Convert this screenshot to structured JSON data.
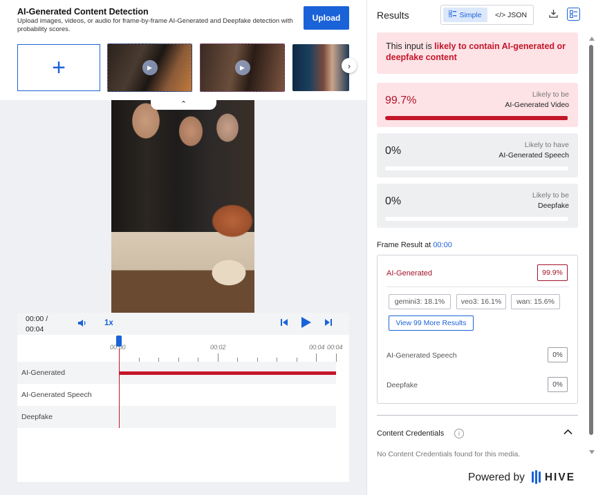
{
  "header": {
    "title": "AI-Generated Content Detection",
    "subtitle": "Upload images, videos, or audio for frame-by-frame AI-Generated and Deepfake detection with probability scores.",
    "upload_label": "Upload",
    "add_symbol": "+",
    "next_symbol": "›"
  },
  "player": {
    "time_current": "00:00 /",
    "time_total": "00:04",
    "speed": "1x",
    "ruler_labels": [
      "00:00",
      "00:02",
      "00:04",
      "00:04"
    ],
    "tracks": [
      {
        "label": "AI-Generated",
        "value": 1.0
      },
      {
        "label": "AI-Generated Speech",
        "value": 0.0
      },
      {
        "label": "Deepfake",
        "value": 0.0
      }
    ],
    "collapse_symbol": "⌃"
  },
  "results": {
    "title": "Results",
    "mode_simple": "Simple",
    "mode_json": "</> JSON",
    "verdict_prefix": "This input is ",
    "verdict_highlight": "likely to contain AI-generated or deepfake content",
    "scores": [
      {
        "value": "99.7%",
        "fraction": 0.997,
        "cap_top": "Likely to be",
        "cap_bottom": "AI-Generated Video"
      },
      {
        "value": "0%",
        "fraction": 0,
        "cap_top": "Likely to have",
        "cap_bottom": "AI-Generated Speech"
      },
      {
        "value": "0%",
        "fraction": 0,
        "cap_top": "Likely to be",
        "cap_bottom": "Deepfake"
      }
    ],
    "frame_label": "Frame Result at ",
    "frame_time": "00:00",
    "frame": {
      "name": "AI-Generated",
      "pct": "99.9%",
      "chips": [
        "gemini3: 18.1%",
        "veo3: 16.1%",
        "wan: 15.6%"
      ],
      "more_label": "View 99 More Results",
      "speech_label": "AI-Generated Speech",
      "speech_pct": "0%",
      "deepfake_label": "Deepfake",
      "deepfake_pct": "0%"
    },
    "credentials_title": "Content Credentials",
    "credentials_none": "No Content Credentials found for this media.",
    "powered_by": "Powered by",
    "brand": "HIVE"
  },
  "colors": {
    "accent": "#1a62d8",
    "danger": "#c4162a",
    "verdict_bg": "#fde2e6"
  }
}
